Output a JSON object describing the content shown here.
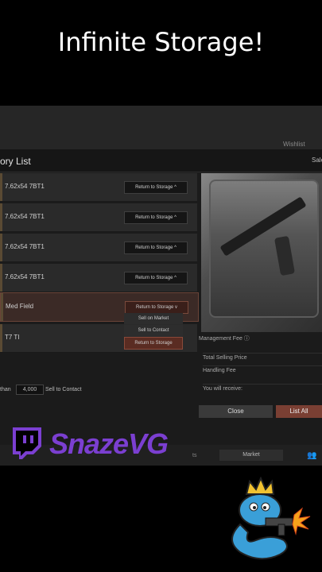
{
  "overlay": {
    "title": "Infinite Storage!"
  },
  "header": {
    "wishlist": "Wishlist",
    "panel_title": "ory List",
    "sales_tab": "Sales"
  },
  "rows": [
    {
      "name": "7.62x54 7BT1",
      "button": "Return to Storage ^"
    },
    {
      "name": "7.62x54 7BT1",
      "button": "Return to Storage ^"
    },
    {
      "name": "7.62x54 7BT1",
      "button": "Return to Storage ^"
    },
    {
      "name": "7.62x54 7BT1",
      "button": "Return to Storage ^"
    },
    {
      "name": "Med Field",
      "button": "Return to Storage v"
    },
    {
      "name": "T7 TI",
      "button": ""
    }
  ],
  "dropdown": [
    "Sell on Market",
    "Sell to Contact",
    "Return to Storage"
  ],
  "filter": {
    "prefix": "than",
    "threshold": "4,000",
    "label": "Sell to Contact"
  },
  "info": {
    "management_fee": "Management Fee ⓘ",
    "total_selling_price": "Total Selling Price",
    "handling_fee": "Handling Fee",
    "you_receive": "You will receive:"
  },
  "actions": {
    "close": "Close",
    "list_all": "List All"
  },
  "bottom": {
    "market_tab": "Market",
    "tab_left": "ts"
  },
  "brand": {
    "name": "SnazeVG",
    "color": "#7b3fd1"
  }
}
